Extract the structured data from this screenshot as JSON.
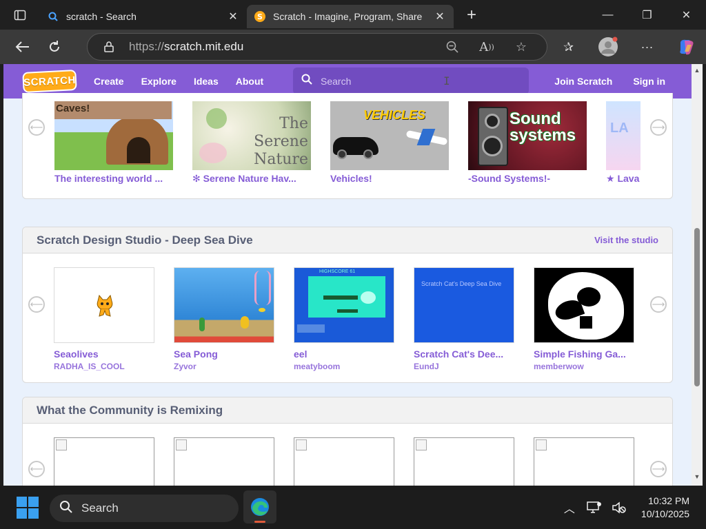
{
  "browser": {
    "tabs": [
      {
        "title": "scratch - Search",
        "active": false
      },
      {
        "title": "Scratch - Imagine, Program, Share",
        "active": true
      }
    ],
    "url_prefix": "https://",
    "url_host": "scratch.mit.edu"
  },
  "scratch_nav": {
    "logo_text": "SCRATCH",
    "links": [
      "Create",
      "Explore",
      "Ideas",
      "About"
    ],
    "search_placeholder": "Search",
    "join": "Join Scratch",
    "signin": "Sign in"
  },
  "featured_row": {
    "projects": [
      {
        "title": "The interesting world ...",
        "thumb_text": "Caves!"
      },
      {
        "title": "✻ Serene Nature Hav...",
        "thumb_text": "The Serene Nature Haven"
      },
      {
        "title": "Vehicles!",
        "thumb_text": "VEHICLES"
      },
      {
        "title": "-Sound Systems!-",
        "thumb_text": "Sound systems"
      },
      {
        "title": "★ Lava",
        "thumb_text": "LA"
      }
    ]
  },
  "studio_section": {
    "title": "Scratch Design Studio - Deep Sea Dive",
    "link": "Visit the studio",
    "projects": [
      {
        "title": "Seaolives",
        "author": "RADHA_IS_COOL"
      },
      {
        "title": "Sea Pong",
        "author": "Zyvor"
      },
      {
        "title": "eel",
        "author": "meatyboom",
        "thumb_text": "HIGHSCORE 61"
      },
      {
        "title": "Scratch Cat's Dee...",
        "author": "EundJ",
        "thumb_text": "Scratch Cat's Deep Sea Dive"
      },
      {
        "title": "Simple Fishing Ga...",
        "author": "memberwow"
      }
    ]
  },
  "remix_section": {
    "title": "What the Community is Remixing"
  },
  "taskbar": {
    "search": "Search",
    "time": "10:32 PM",
    "date": "10/10/2025"
  },
  "colors": {
    "scratch_purple": "#855cd6",
    "scratch_orange": "#ffab19",
    "page_bg": "#e9f1fc"
  }
}
